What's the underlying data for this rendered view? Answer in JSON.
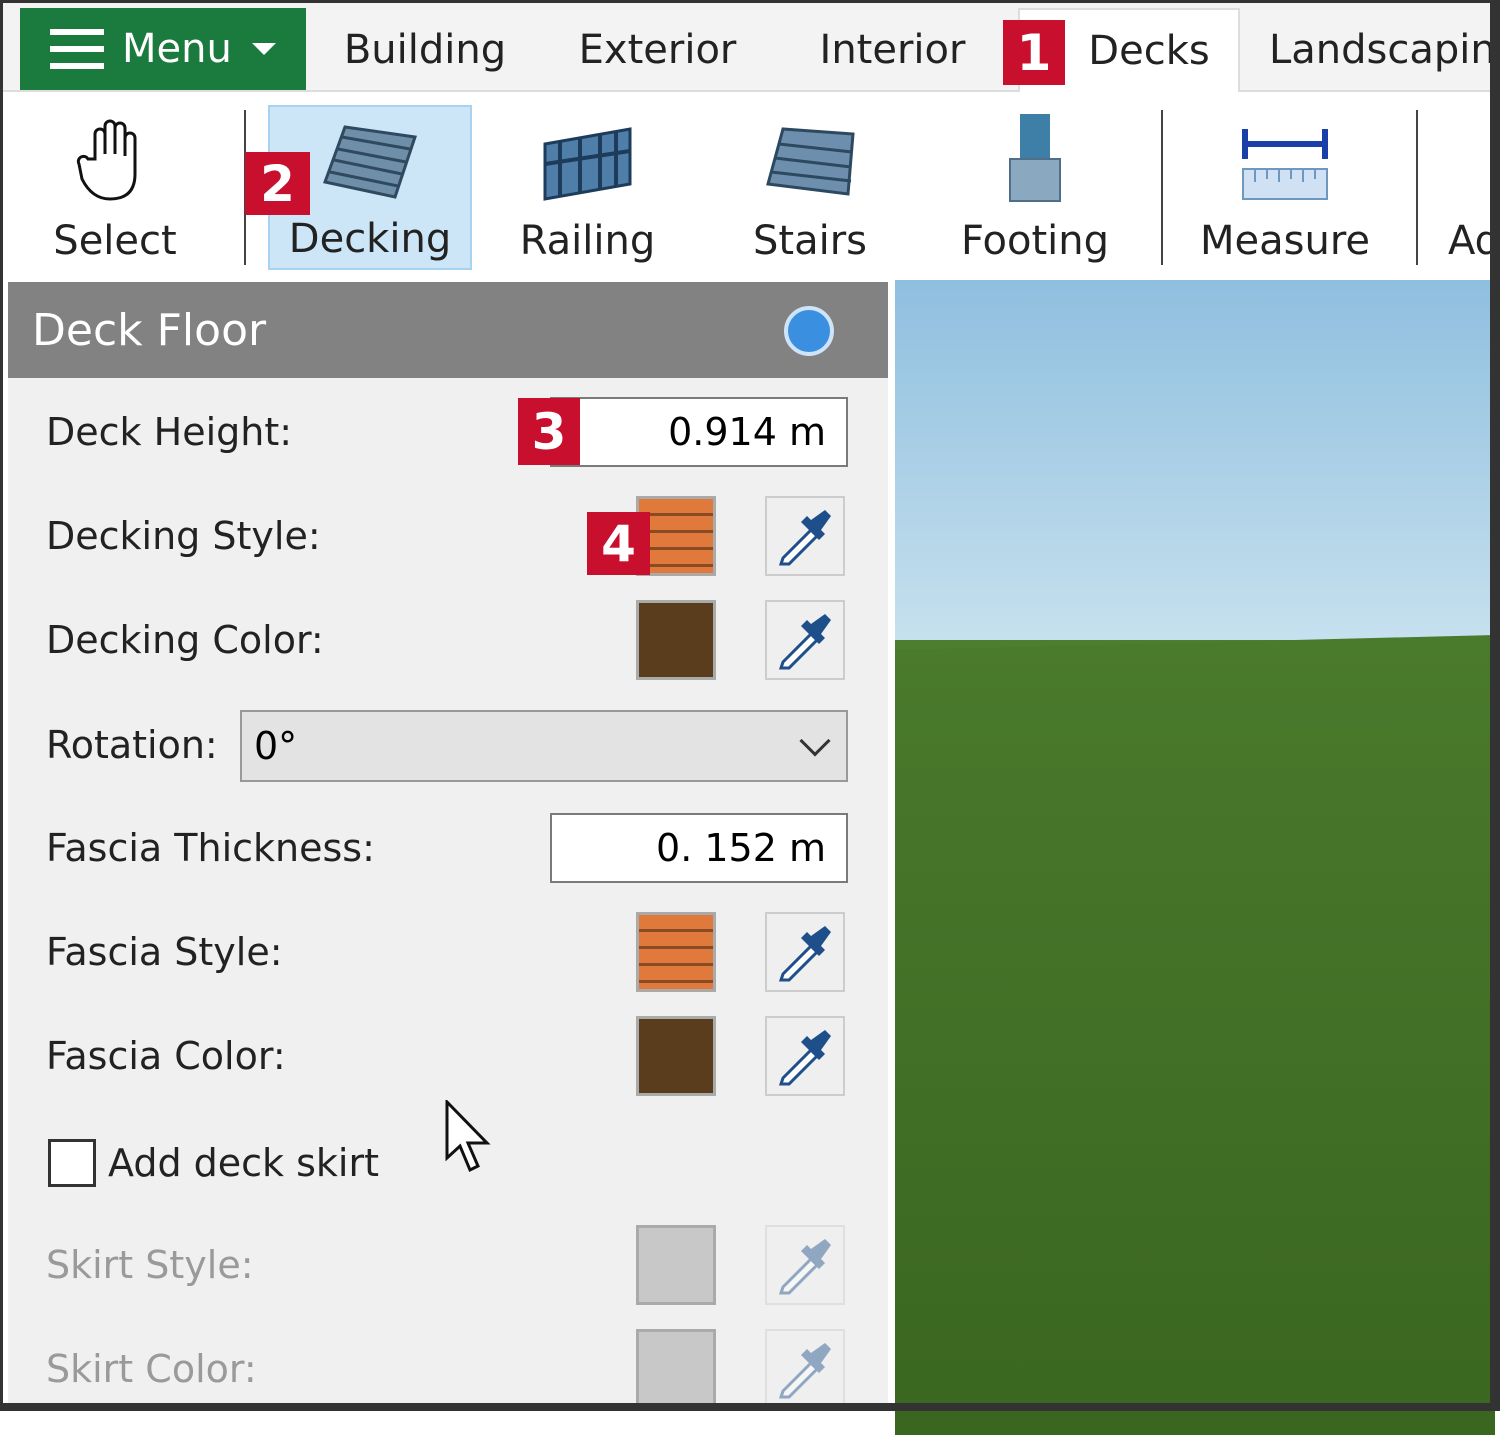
{
  "topbar": {
    "menu_label": "Menu",
    "tabs": [
      "Building",
      "Exterior",
      "Interior",
      "Decks",
      "Landscaping"
    ],
    "active_tab": "Decks"
  },
  "ribbon": {
    "items": [
      "Select",
      "Decking",
      "Railing",
      "Stairs",
      "Footing",
      "Measure",
      "Ad"
    ],
    "selected": "Decking"
  },
  "badges": [
    "1",
    "2",
    "3",
    "4"
  ],
  "panel": {
    "title": "Deck Floor",
    "deck_height_label": "Deck Height:",
    "deck_height_value": "0.914 m",
    "decking_style_label": "Decking Style:",
    "decking_color_label": "Decking Color:",
    "rotation_label": "Rotation:",
    "rotation_value": "0°",
    "fascia_thickness_label": "Fascia Thickness:",
    "fascia_thickness_value": "0. 152 m",
    "fascia_style_label": "Fascia Style:",
    "fascia_color_label": "Fascia Color:",
    "skirt_checkbox_label": "Add deck skirt",
    "skirt_checked": false,
    "skirt_style_label": "Skirt Style:",
    "skirt_color_label": "Skirt Color:"
  },
  "colors": {
    "menu_green": "#1b7a3e",
    "badge_red": "#c8102e",
    "decking_color": "#5a3d1c",
    "fascia_color": "#5a3d1c"
  }
}
